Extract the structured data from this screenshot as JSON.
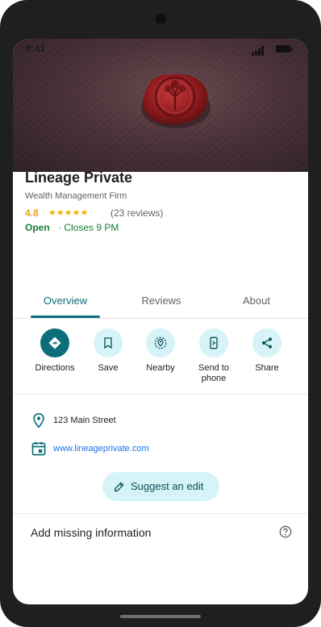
{
  "status_bar": {
    "time": "9:41"
  },
  "place": {
    "name": "Lineage Private",
    "category": "Wealth Management Firm",
    "rating": "4.8",
    "stars": "★★★★★",
    "reviews": "(23 reviews)",
    "open_status": "Open",
    "closes": "· Closes 9 PM"
  },
  "tabs": [
    {
      "label": "Overview",
      "active": true
    },
    {
      "label": "Reviews",
      "active": false
    },
    {
      "label": "About",
      "active": false
    }
  ],
  "actions": [
    {
      "label": "Directions",
      "icon": "directions-icon"
    },
    {
      "label": "Save",
      "icon": "bookmark-icon"
    },
    {
      "label": "Nearby",
      "icon": "nearby-icon"
    },
    {
      "label": "Send to phone",
      "icon": "send-to-phone-icon"
    },
    {
      "label": "Share",
      "icon": "share-icon"
    }
  ],
  "details": {
    "address": "123 Main Street",
    "website": "www.lineageprivate.com"
  },
  "suggest_edit": "Suggest an edit",
  "add_missing": "Add missing information",
  "colors": {
    "accent": "#0b6e7a",
    "accent_light": "#d6f3f7",
    "open_green": "#188038",
    "star": "#f4b400",
    "link": "#1a73e8"
  }
}
